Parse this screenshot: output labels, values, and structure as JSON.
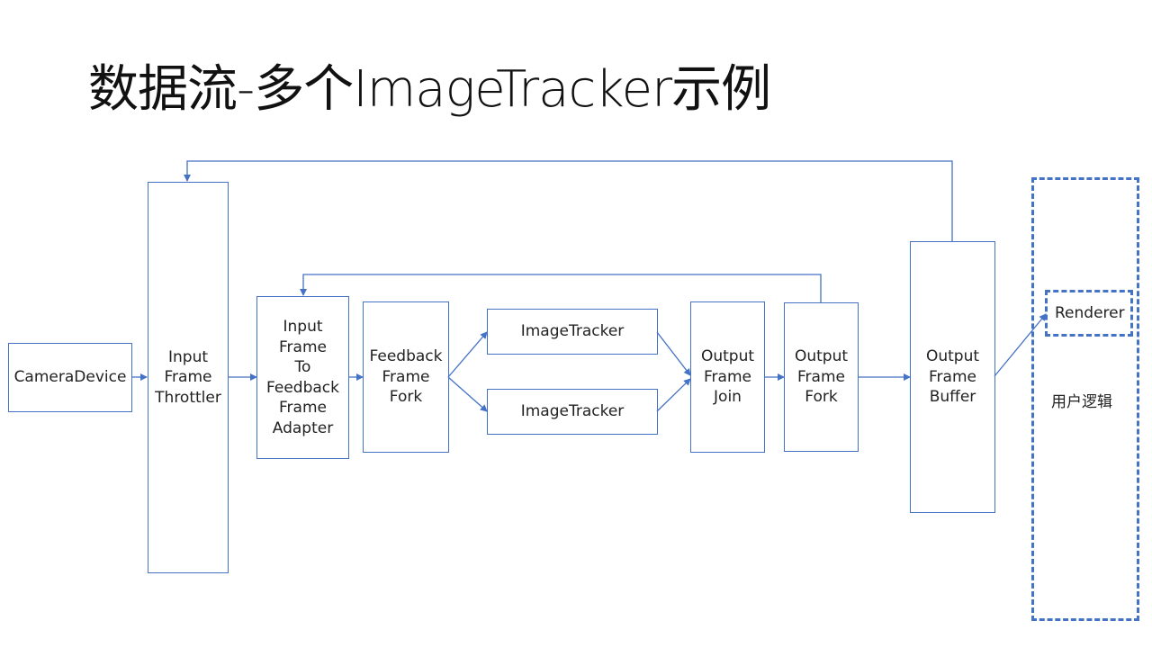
{
  "title": "数据流-多个ImageTracker示例",
  "colors": {
    "stroke": "#4472C4",
    "text": "#222222",
    "background": "#ffffff"
  },
  "nodes": {
    "camera_device": "CameraDevice",
    "input_frame_throttler": "Input\nFrame\nThrottler",
    "input_frame_to_feedback_frame_adapter": "Input\nFrame\nTo\nFeedback\nFrame\nAdapter",
    "feedback_frame_fork": "Feedback\nFrame\nFork",
    "image_tracker_1": "ImageTracker",
    "image_tracker_2": "ImageTracker",
    "output_frame_join": "Output\nFrame\nJoin",
    "output_frame_fork": "Output\nFrame\nFork",
    "output_frame_buffer": "Output\nFrame\nBuffer",
    "renderer": "Renderer",
    "user_logic": "用户逻辑"
  },
  "edges": [
    {
      "from": "camera_device",
      "to": "input_frame_throttler"
    },
    {
      "from": "input_frame_throttler",
      "to": "input_frame_to_feedback_frame_adapter"
    },
    {
      "from": "input_frame_to_feedback_frame_adapter",
      "to": "feedback_frame_fork"
    },
    {
      "from": "feedback_frame_fork",
      "to": "image_tracker_1"
    },
    {
      "from": "feedback_frame_fork",
      "to": "image_tracker_2"
    },
    {
      "from": "image_tracker_1",
      "to": "output_frame_join"
    },
    {
      "from": "image_tracker_2",
      "to": "output_frame_join"
    },
    {
      "from": "output_frame_join",
      "to": "output_frame_fork"
    },
    {
      "from": "output_frame_fork",
      "to": "output_frame_buffer"
    },
    {
      "from": "output_frame_fork",
      "to": "input_frame_to_feedback_frame_adapter",
      "type": "feedback"
    },
    {
      "from": "output_frame_buffer",
      "to": "input_frame_throttler",
      "type": "feedback"
    },
    {
      "from": "output_frame_buffer",
      "to": "renderer"
    }
  ]
}
